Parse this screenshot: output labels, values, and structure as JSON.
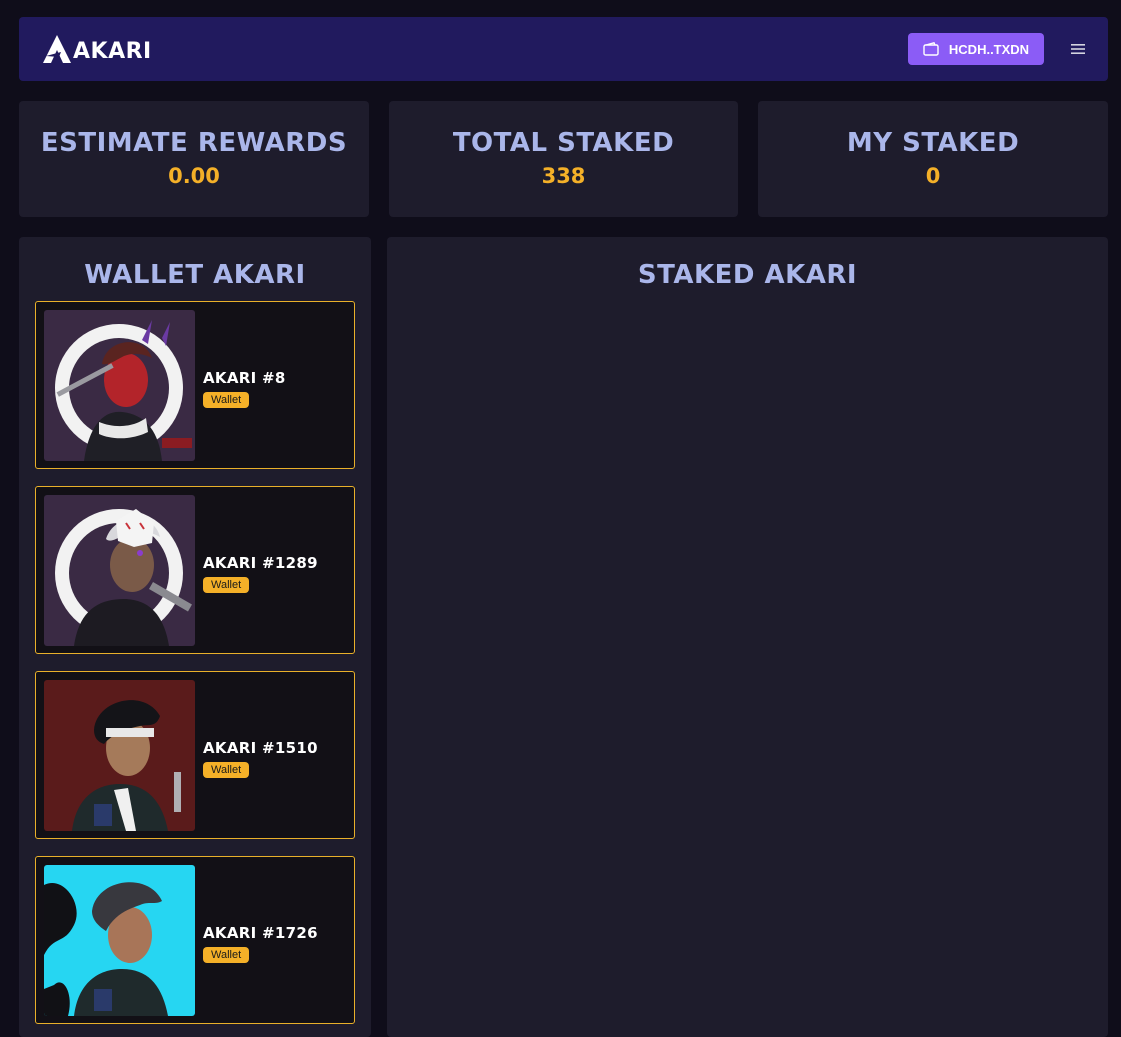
{
  "brand": {
    "name": "AKARI"
  },
  "header": {
    "wallet_label": "HCDH..TXDN",
    "wallet_icon": "wallet-icon",
    "menu_icon": "hamburger-menu-icon"
  },
  "stats": [
    {
      "title": "ESTIMATE REWARDS",
      "value": "0.00"
    },
    {
      "title": "TOTAL STAKED",
      "value": "338"
    },
    {
      "title": "MY STAKED",
      "value": "0"
    }
  ],
  "wallet_panel": {
    "title": "WALLET AKARI",
    "items": [
      {
        "name": "AKARI #8",
        "badge": "Wallet"
      },
      {
        "name": "AKARI #1289",
        "badge": "Wallet"
      },
      {
        "name": "AKARI #1510",
        "badge": "Wallet"
      },
      {
        "name": "AKARI #1726",
        "badge": "Wallet"
      }
    ]
  },
  "staked_panel": {
    "title": "STAKED AKARI"
  },
  "colors": {
    "accent": "#8b5cf6",
    "gold": "#f4b028",
    "nav": "#211a5e",
    "card": "#1e1c2c",
    "title": "#aab6ea"
  }
}
